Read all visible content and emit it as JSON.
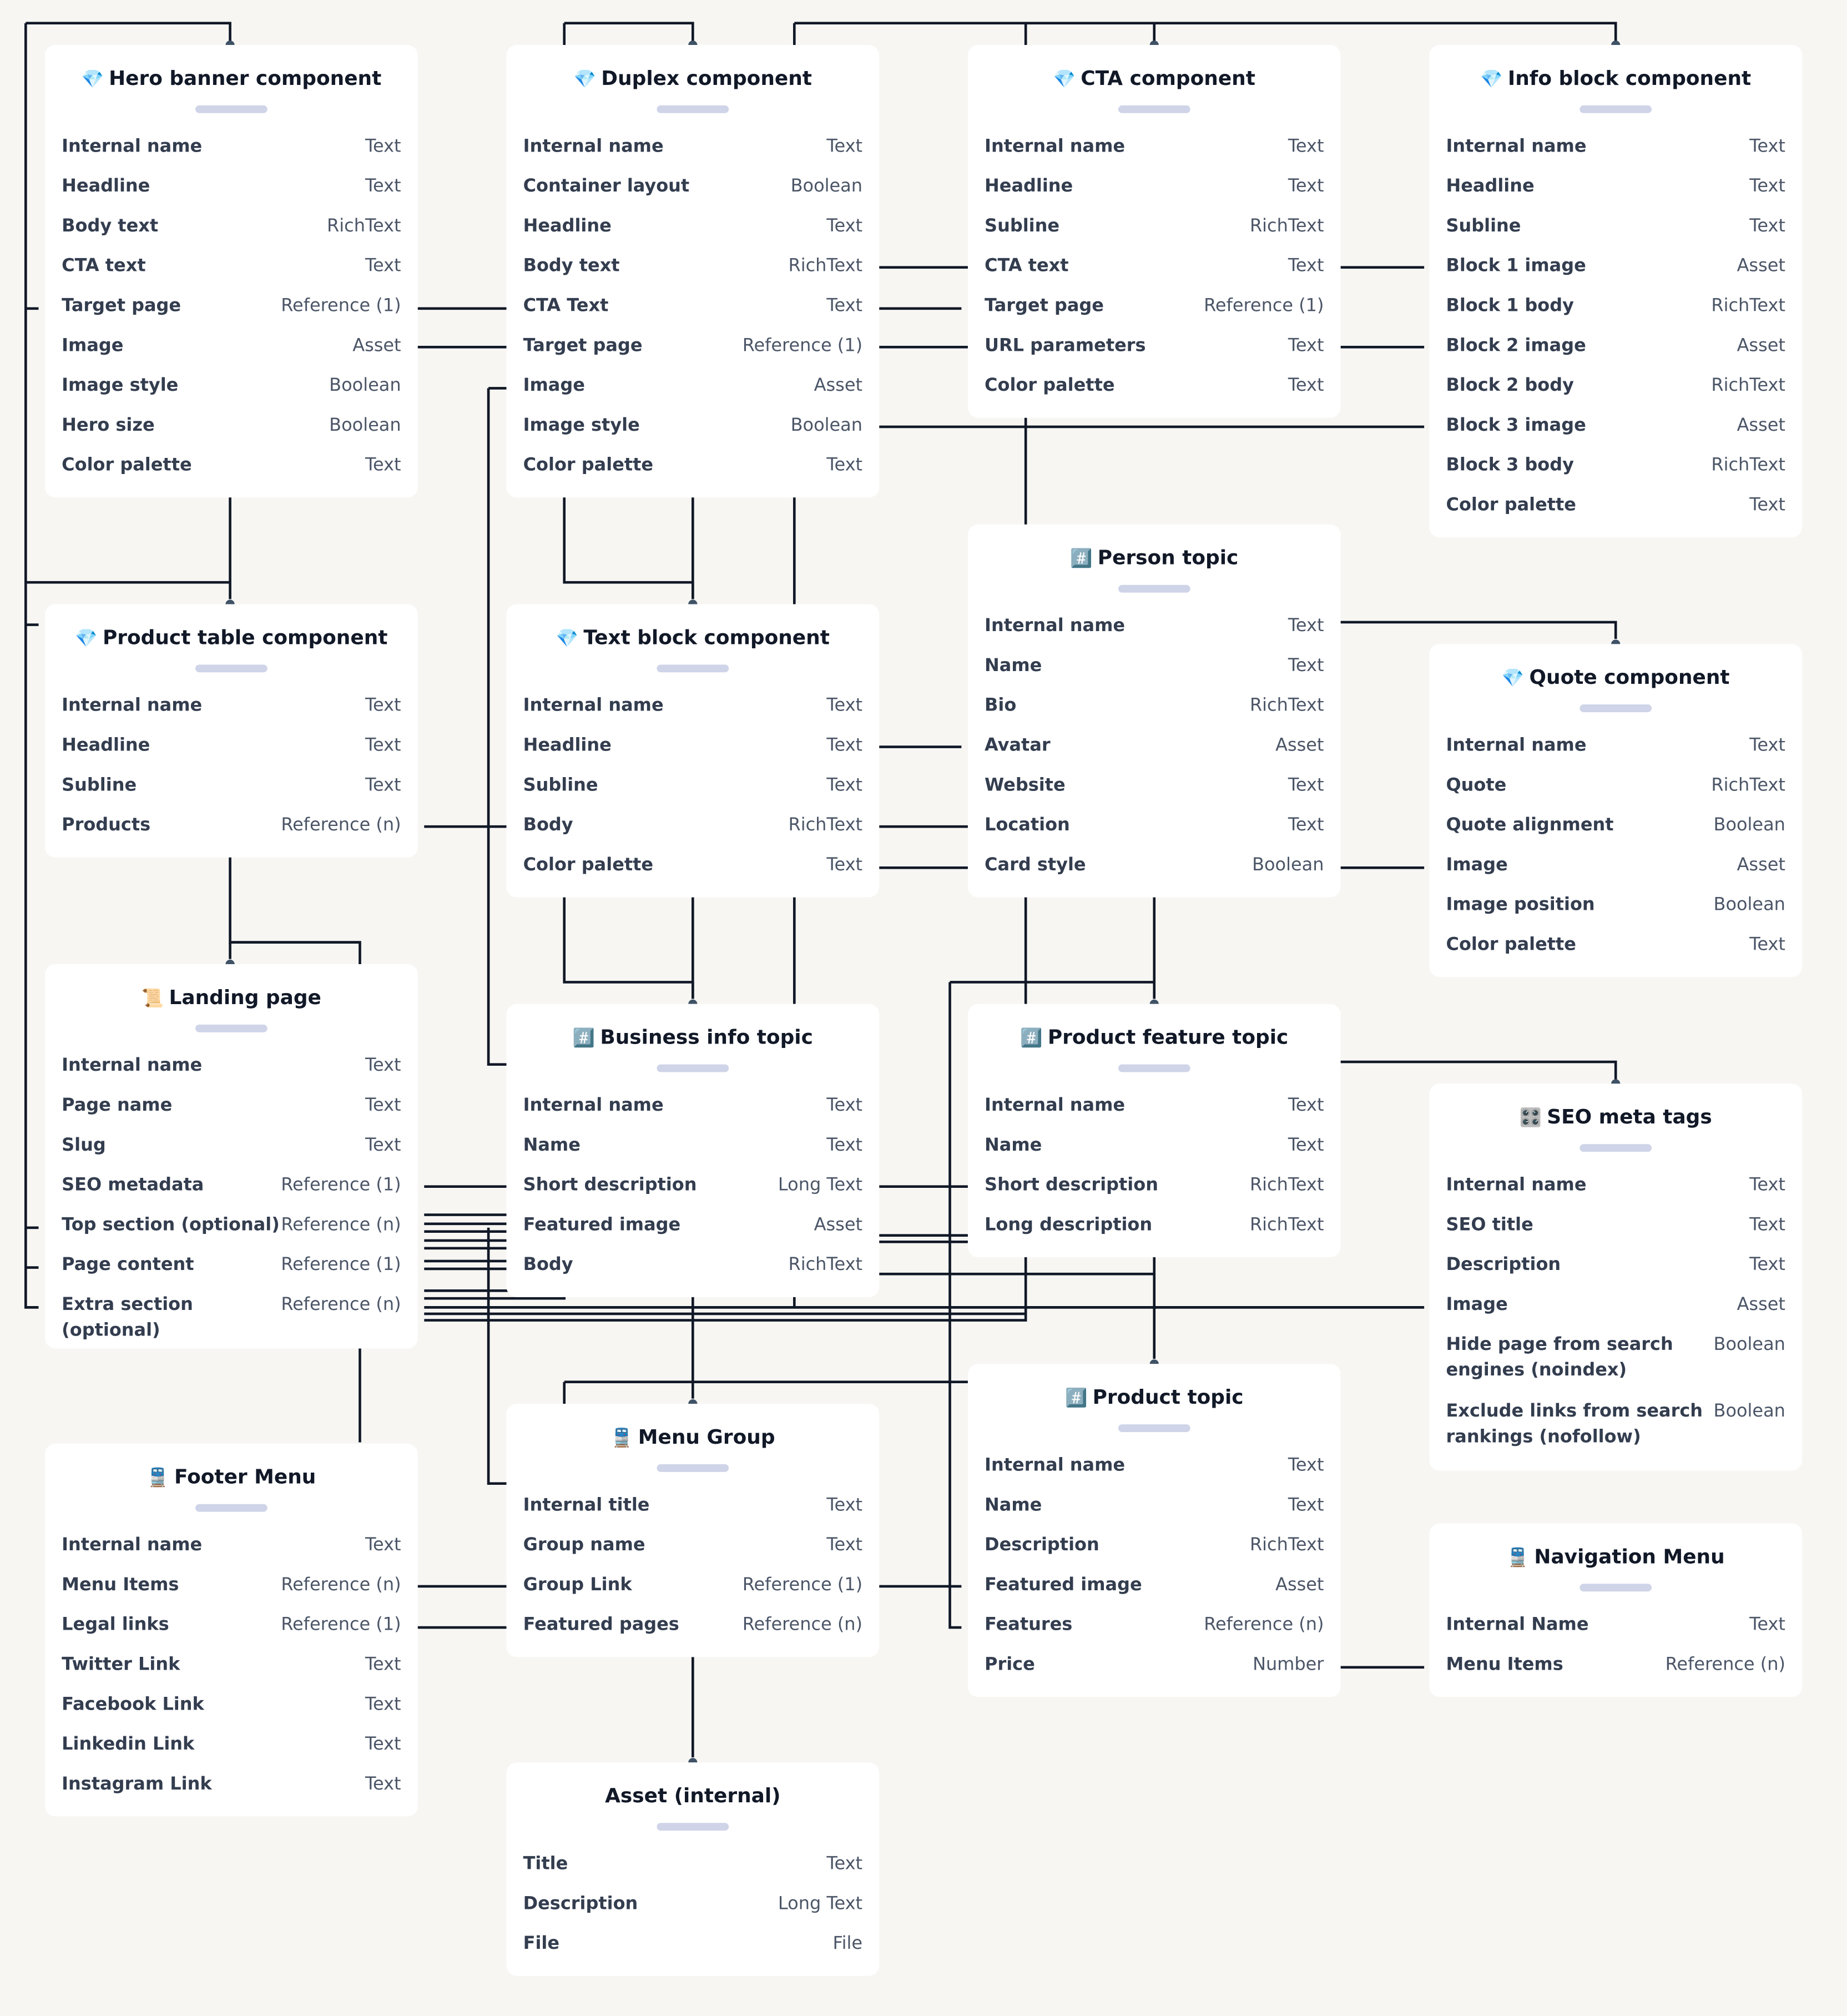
{
  "canvas": {
    "background": "#f7f6f3",
    "card_background": "#ffffff",
    "connector_color": "#111827",
    "pill_color": "#cfd4e8"
  },
  "cards": {
    "hero": {
      "icon": "💎",
      "title": "Hero banner component",
      "fields": [
        {
          "name": "Internal name",
          "type": "Text"
        },
        {
          "name": "Headline",
          "type": "Text"
        },
        {
          "name": "Body text",
          "type": "RichText"
        },
        {
          "name": "CTA text",
          "type": "Text"
        },
        {
          "name": "Target page",
          "type": "Reference (1)"
        },
        {
          "name": "Image",
          "type": "Asset"
        },
        {
          "name": "Image style",
          "type": "Boolean"
        },
        {
          "name": "Hero size",
          "type": "Boolean"
        },
        {
          "name": "Color palette",
          "type": "Text"
        }
      ]
    },
    "duplex": {
      "icon": "💎",
      "title": "Duplex component",
      "fields": [
        {
          "name": "Internal name",
          "type": "Text"
        },
        {
          "name": "Container layout",
          "type": "Boolean"
        },
        {
          "name": "Headline",
          "type": "Text"
        },
        {
          "name": "Body text",
          "type": "RichText"
        },
        {
          "name": "CTA Text",
          "type": "Text"
        },
        {
          "name": "Target page",
          "type": "Reference (1)"
        },
        {
          "name": "Image",
          "type": "Asset"
        },
        {
          "name": "Image style",
          "type": "Boolean"
        },
        {
          "name": "Color palette",
          "type": "Text"
        }
      ]
    },
    "cta": {
      "icon": "💎",
      "title": "CTA component",
      "fields": [
        {
          "name": "Internal name",
          "type": "Text"
        },
        {
          "name": "Headline",
          "type": "Text"
        },
        {
          "name": "Subline",
          "type": "RichText"
        },
        {
          "name": "CTA text",
          "type": "Text"
        },
        {
          "name": "Target page",
          "type": "Reference (1)"
        },
        {
          "name": "URL parameters",
          "type": "Text"
        },
        {
          "name": "Color palette",
          "type": "Text"
        }
      ]
    },
    "info": {
      "icon": "💎",
      "title": "Info block component",
      "fields": [
        {
          "name": "Internal name",
          "type": "Text"
        },
        {
          "name": "Headline",
          "type": "Text"
        },
        {
          "name": "Subline",
          "type": "Text"
        },
        {
          "name": "Block 1 image",
          "type": "Asset"
        },
        {
          "name": "Block 1 body",
          "type": "RichText"
        },
        {
          "name": "Block 2 image",
          "type": "Asset"
        },
        {
          "name": "Block 2 body",
          "type": "RichText"
        },
        {
          "name": "Block 3 image",
          "type": "Asset"
        },
        {
          "name": "Block 3 body",
          "type": "RichText"
        },
        {
          "name": "Color palette",
          "type": "Text"
        }
      ]
    },
    "product_table": {
      "icon": "💎",
      "title": "Product table component",
      "fields": [
        {
          "name": "Internal name",
          "type": "Text"
        },
        {
          "name": "Headline",
          "type": "Text"
        },
        {
          "name": "Subline",
          "type": "Text"
        },
        {
          "name": "Products",
          "type": "Reference (n)"
        }
      ]
    },
    "text_block": {
      "icon": "💎",
      "title": "Text block component",
      "fields": [
        {
          "name": "Internal name",
          "type": "Text"
        },
        {
          "name": "Headline",
          "type": "Text"
        },
        {
          "name": "Subline",
          "type": "Text"
        },
        {
          "name": "Body",
          "type": "RichText"
        },
        {
          "name": "Color palette",
          "type": "Text"
        }
      ]
    },
    "person": {
      "icon": "#️⃣",
      "title": "Person topic",
      "fields": [
        {
          "name": "Internal name",
          "type": "Text"
        },
        {
          "name": "Name",
          "type": "Text"
        },
        {
          "name": "Bio",
          "type": "RichText"
        },
        {
          "name": "Avatar",
          "type": "Asset"
        },
        {
          "name": "Website",
          "type": "Text"
        },
        {
          "name": "Location",
          "type": "Text"
        },
        {
          "name": "Card style",
          "type": "Boolean"
        }
      ]
    },
    "quote": {
      "icon": "💎",
      "title": "Quote component",
      "fields": [
        {
          "name": "Internal name",
          "type": "Text"
        },
        {
          "name": "Quote",
          "type": "RichText"
        },
        {
          "name": "Quote alignment",
          "type": "Boolean"
        },
        {
          "name": "Image",
          "type": "Asset"
        },
        {
          "name": "Image position",
          "type": "Boolean"
        },
        {
          "name": "Color palette",
          "type": "Text"
        }
      ]
    },
    "landing": {
      "icon": "📜",
      "title": "Landing page",
      "fields": [
        {
          "name": "Internal name",
          "type": "Text"
        },
        {
          "name": "Page name",
          "type": "Text"
        },
        {
          "name": "Slug",
          "type": "Text"
        },
        {
          "name": "SEO metadata",
          "type": "Reference (1)"
        },
        {
          "name": "Top section (optional)",
          "type": "Reference (n)"
        },
        {
          "name": "Page content",
          "type": "Reference (1)"
        },
        {
          "name": "Extra section (optional)",
          "type": "Reference (n)"
        }
      ]
    },
    "business": {
      "icon": "#️⃣",
      "title": "Business info topic",
      "fields": [
        {
          "name": "Internal name",
          "type": "Text"
        },
        {
          "name": "Name",
          "type": "Text"
        },
        {
          "name": "Short description",
          "type": "Long Text"
        },
        {
          "name": "Featured image",
          "type": "Asset"
        },
        {
          "name": "Body",
          "type": "RichText"
        }
      ]
    },
    "product_feature": {
      "icon": "#️⃣",
      "title": "Product feature topic",
      "fields": [
        {
          "name": "Internal name",
          "type": "Text"
        },
        {
          "name": "Name",
          "type": "Text"
        },
        {
          "name": "Short description",
          "type": "RichText"
        },
        {
          "name": "Long description",
          "type": "RichText"
        }
      ]
    },
    "seo": {
      "icon": "🎛️",
      "title": "SEO meta tags",
      "fields": [
        {
          "name": "Internal name",
          "type": "Text"
        },
        {
          "name": "SEO title",
          "type": "Text"
        },
        {
          "name": "Description",
          "type": "Text"
        },
        {
          "name": "Image",
          "type": "Asset"
        },
        {
          "name": "Hide page from search engines (noindex)",
          "type": "Boolean"
        },
        {
          "name": "Exclude links from search rankings (nofollow)",
          "type": "Boolean"
        }
      ]
    },
    "footer": {
      "icon": "🚆",
      "title": "Footer Menu",
      "fields": [
        {
          "name": "Internal name",
          "type": "Text"
        },
        {
          "name": "Menu Items",
          "type": "Reference (n)"
        },
        {
          "name": "Legal links",
          "type": "Reference (1)"
        },
        {
          "name": "Twitter Link",
          "type": "Text"
        },
        {
          "name": "Facebook Link",
          "type": "Text"
        },
        {
          "name": "Linkedin Link",
          "type": "Text"
        },
        {
          "name": "Instagram Link",
          "type": "Text"
        }
      ]
    },
    "menu_group": {
      "icon": "🚆",
      "title": "Menu Group",
      "fields": [
        {
          "name": "Internal title",
          "type": "Text"
        },
        {
          "name": "Group name",
          "type": "Text"
        },
        {
          "name": "Group Link",
          "type": "Reference (1)"
        },
        {
          "name": "Featured pages",
          "type": "Reference (n)"
        }
      ]
    },
    "product_topic": {
      "icon": "#️⃣",
      "title": "Product topic",
      "fields": [
        {
          "name": "Internal name",
          "type": "Text"
        },
        {
          "name": "Name",
          "type": "Text"
        },
        {
          "name": "Description",
          "type": "RichText"
        },
        {
          "name": "Featured image",
          "type": "Asset"
        },
        {
          "name": "Features",
          "type": "Reference (n)"
        },
        {
          "name": "Price",
          "type": "Number"
        }
      ]
    },
    "nav_menu": {
      "icon": "🚆",
      "title": "Navigation Menu",
      "fields": [
        {
          "name": "Internal Name",
          "type": "Text"
        },
        {
          "name": "Menu Items",
          "type": "Reference (n)"
        }
      ]
    },
    "asset": {
      "icon": "",
      "title": "Asset (internal)",
      "fields": [
        {
          "name": "Title",
          "type": "Text"
        },
        {
          "name": "Description",
          "type": "Long Text"
        },
        {
          "name": "File",
          "type": "File"
        }
      ]
    }
  }
}
